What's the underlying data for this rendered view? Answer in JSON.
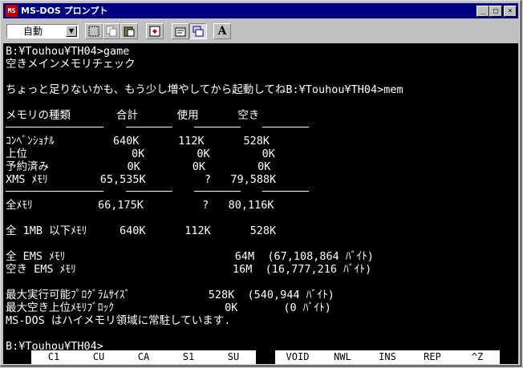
{
  "window": {
    "title": "MS-DOS プロンプト",
    "icon_label": "MS",
    "controls": {
      "minimize": "_",
      "maximize": "□",
      "close": "×"
    }
  },
  "toolbar": {
    "font_select_value": "自動",
    "font_select_arrow": "▼",
    "font_button_label": "A"
  },
  "console": {
    "lines": [
      "B:¥Touhou¥TH04>game",
      "空きメインメモリチェック",
      "",
      "ちょっと足りないかも、もう少し増やしてから起動してねB:¥Touhou¥TH04>mem",
      "",
      "メモリの種類       合計      使用      空き",
      "",
      "ｺﾝﾍﾞﾝｼｮﾅﾙ         640K      112K      528K",
      "上位                0K        0K        0K",
      "予約済み            0K        0K        0K",
      "XMS ﾒﾓﾘ        65,535K         ?   79,588K",
      "",
      "全ﾒﾓﾘ          66,175K         ?   80,116K",
      "",
      "全 1MB 以下ﾒﾓﾘ     640K      112K      528K",
      "",
      "全 EMS ﾒﾓﾘ                          64M  (67,108,864 ﾊﾞｲﾄ)",
      "空き EMS ﾒﾓﾘ                        16M  (16,777,216 ﾊﾞｲﾄ)",
      "",
      "最大実行可能ﾌﾟﾛｸﾞﾗﾑｻｲｽﾞ            528K  (540,944 ﾊﾞｲﾄ)",
      "最大空き上位ﾒﾓﾘﾌﾞﾛｯｸ                 0K       (0 ﾊﾞｲﾄ)",
      "MS-DOS はハイメモリ領域に常駐しています.",
      "",
      "B:¥Touhou¥TH04>"
    ]
  },
  "function_keys": [
    "C1",
    "CU",
    "CA",
    "S1",
    "SU",
    "VOID",
    "NWL",
    "INS",
    "REP",
    "^Z"
  ],
  "colors": {
    "title_bar": "#000080",
    "console_bg": "#000000",
    "console_fg": "#ffffff",
    "chrome": "#c0c0c0"
  }
}
